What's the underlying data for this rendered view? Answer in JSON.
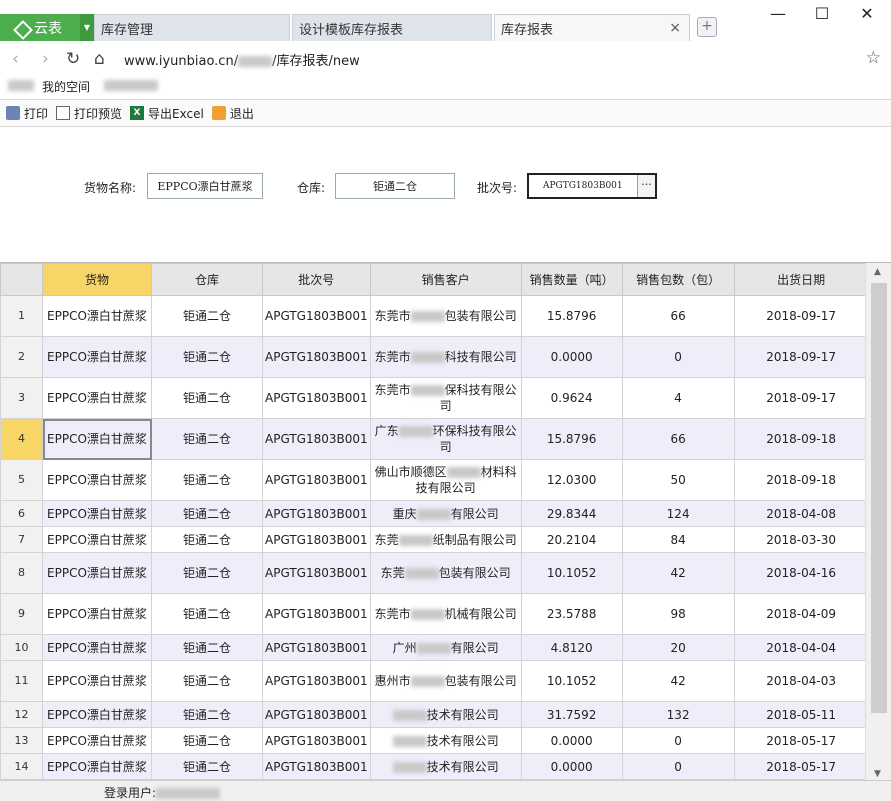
{
  "browser": {
    "logo_label": "云表",
    "tabs": [
      {
        "label": "库存管理"
      },
      {
        "label": "设计模板库存报表"
      },
      {
        "label": "库存报表",
        "active": true
      }
    ],
    "close_glyph": "×",
    "new_tab_glyph": "+",
    "window_controls": [
      "—",
      "☐",
      "✕"
    ],
    "url_prefix": "www.iyunbiao.cn/",
    "url_suffix": "/库存报表/new",
    "bookmarks": [
      {
        "label": "我的空间"
      }
    ]
  },
  "toolbar": {
    "print": "打印",
    "print_preview": "打印预览",
    "export_excel": "导出Excel",
    "exit": "退出"
  },
  "filters": {
    "goods_label": "货物名称:",
    "goods_value": "EPPCO漂白甘蔗浆",
    "warehouse_label": "仓库:",
    "warehouse_value": "钜通二仓",
    "batch_label": "批次号:",
    "batch_value": "APGTG1803B001",
    "more_glyph": "···"
  },
  "table": {
    "headers": [
      "货物",
      "仓库",
      "批次号",
      "销售客户",
      "销售数量（吨）",
      "销售包数（包）",
      "出货日期"
    ],
    "rows": [
      {
        "n": "1",
        "goods": "EPPCO漂白甘蔗浆",
        "wh": "钜通二仓",
        "batch": "APGTG1803B001",
        "c1": "东莞市",
        "c2": "包装有限公司",
        "qty": "15.8796",
        "pkg": "66",
        "date": "2018-09-17"
      },
      {
        "n": "2",
        "goods": "EPPCO漂白甘蔗浆",
        "wh": "钜通二仓",
        "batch": "APGTG1803B001",
        "c1": "东莞市",
        "c2": "科技有限公司",
        "qty": "0.0000",
        "pkg": "0",
        "date": "2018-09-17"
      },
      {
        "n": "3",
        "goods": "EPPCO漂白甘蔗浆",
        "wh": "钜通二仓",
        "batch": "APGTG1803B001",
        "c1": "东莞市",
        "c2": "保科技有限公司",
        "qty": "0.9624",
        "pkg": "4",
        "date": "2018-09-17"
      },
      {
        "n": "4",
        "goods": "EPPCO漂白甘蔗浆",
        "wh": "钜通二仓",
        "batch": "APGTG1803B001",
        "c1": "广东",
        "c2": "环保科技有限公司",
        "qty": "15.8796",
        "pkg": "66",
        "date": "2018-09-18"
      },
      {
        "n": "5",
        "goods": "EPPCO漂白甘蔗浆",
        "wh": "钜通二仓",
        "batch": "APGTG1803B001",
        "c1": "佛山市顺德区",
        "c2": "材料科技有限公司",
        "qty": "12.0300",
        "pkg": "50",
        "date": "2018-09-18"
      },
      {
        "n": "6",
        "goods": "EPPCO漂白甘蔗浆",
        "wh": "钜通二仓",
        "batch": "APGTG1803B001",
        "c1": "重庆",
        "c2": "有限公司",
        "qty": "29.8344",
        "pkg": "124",
        "date": "2018-04-08"
      },
      {
        "n": "7",
        "goods": "EPPCO漂白甘蔗浆",
        "wh": "钜通二仓",
        "batch": "APGTG1803B001",
        "c1": "东莞",
        "c2": "纸制品有限公司",
        "qty": "20.2104",
        "pkg": "84",
        "date": "2018-03-30"
      },
      {
        "n": "8",
        "goods": "EPPCO漂白甘蔗浆",
        "wh": "钜通二仓",
        "batch": "APGTG1803B001",
        "c1": "东莞",
        "c2": "包装有限公司",
        "qty": "10.1052",
        "pkg": "42",
        "date": "2018-04-16"
      },
      {
        "n": "9",
        "goods": "EPPCO漂白甘蔗浆",
        "wh": "钜通二仓",
        "batch": "APGTG1803B001",
        "c1": "东莞市",
        "c2": "机械有限公司",
        "qty": "23.5788",
        "pkg": "98",
        "date": "2018-04-09"
      },
      {
        "n": "10",
        "goods": "EPPCO漂白甘蔗浆",
        "wh": "钜通二仓",
        "batch": "APGTG1803B001",
        "c1": "广州",
        "c2": "有限公司",
        "qty": "4.8120",
        "pkg": "20",
        "date": "2018-04-04"
      },
      {
        "n": "11",
        "goods": "EPPCO漂白甘蔗浆",
        "wh": "钜通二仓",
        "batch": "APGTG1803B001",
        "c1": "惠州市",
        "c2": "包装有限公司",
        "qty": "10.1052",
        "pkg": "42",
        "date": "2018-04-03"
      },
      {
        "n": "12",
        "goods": "EPPCO漂白甘蔗浆",
        "wh": "钜通二仓",
        "batch": "APGTG1803B001",
        "c1": "",
        "c2": "技术有限公司",
        "qty": "31.7592",
        "pkg": "132",
        "date": "2018-05-11"
      },
      {
        "n": "13",
        "goods": "EPPCO漂白甘蔗浆",
        "wh": "钜通二仓",
        "batch": "APGTG1803B001",
        "c1": "",
        "c2": "技术有限公司",
        "qty": "0.0000",
        "pkg": "0",
        "date": "2018-05-17"
      },
      {
        "n": "14",
        "goods": "EPPCO漂白甘蔗浆",
        "wh": "钜通二仓",
        "batch": "APGTG1803B001",
        "c1": "",
        "c2": "技术有限公司",
        "qty": "0.0000",
        "pkg": "0",
        "date": "2018-05-17"
      }
    ]
  },
  "status": {
    "login_label": "登录用户:"
  },
  "colors": {
    "brand_green": "#4cae4c",
    "header_highlight": "#f7d566",
    "row_alt": "#eeeefb"
  }
}
